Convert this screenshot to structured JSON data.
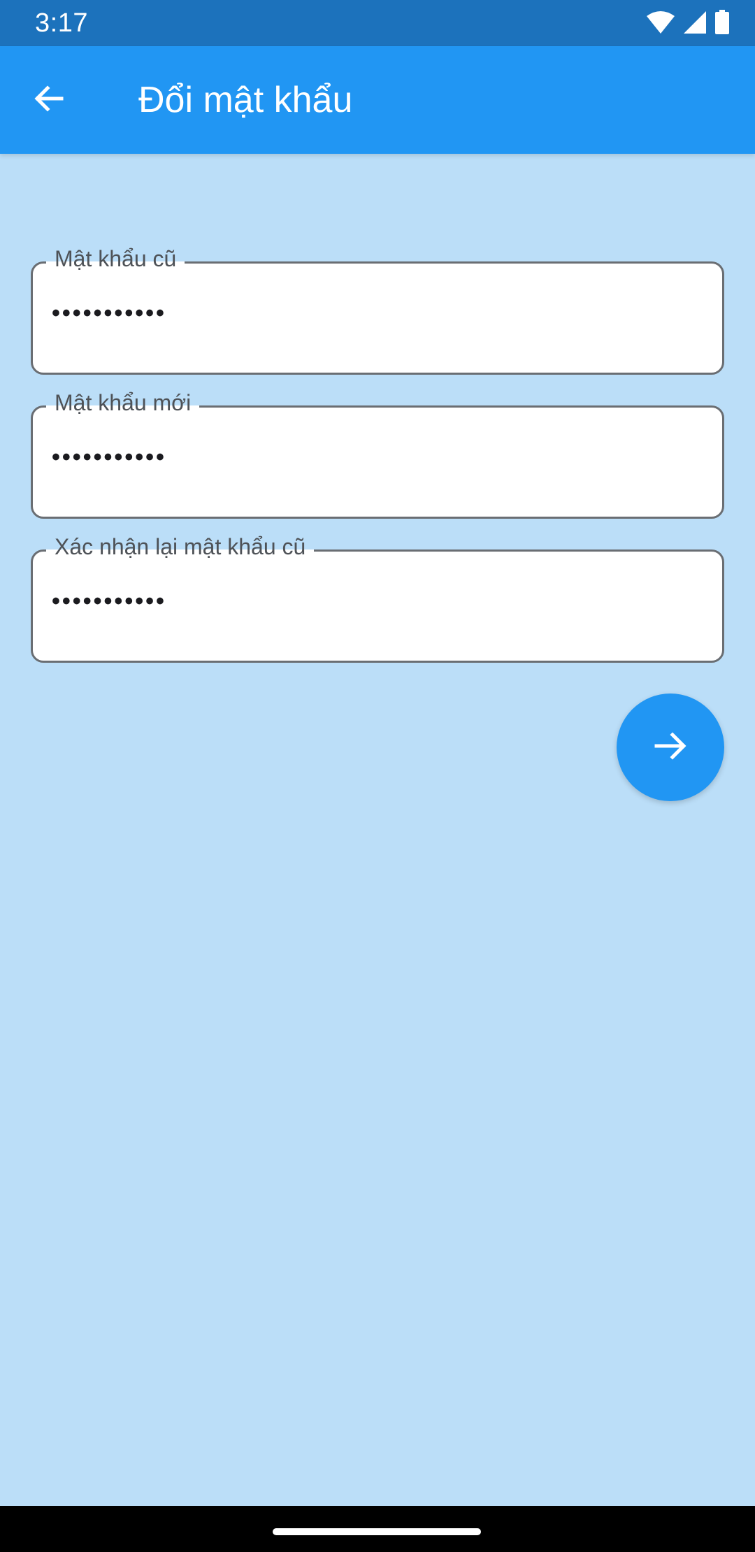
{
  "status_bar": {
    "time": "3:17",
    "icons": [
      "wifi-icon",
      "cell-signal-icon",
      "battery-icon"
    ]
  },
  "app_bar": {
    "title": "Đổi mật khẩu",
    "back_icon": "arrow-back-icon",
    "background": "#2196F3"
  },
  "form": {
    "fields": [
      {
        "label": "Mật khẩu cũ",
        "value": "•••••••••••"
      },
      {
        "label": "Mật khẩu mới",
        "value": "•••••••••••"
      },
      {
        "label": "Xác nhận lại mật khẩu cũ",
        "value": "•••••••••••"
      }
    ],
    "submit_icon": "arrow-forward-icon"
  },
  "colors": {
    "status_bar": "#1C72BC",
    "accent": "#2196F3",
    "page_background": "#BBDEF8",
    "field_border": "#6A6E73"
  }
}
